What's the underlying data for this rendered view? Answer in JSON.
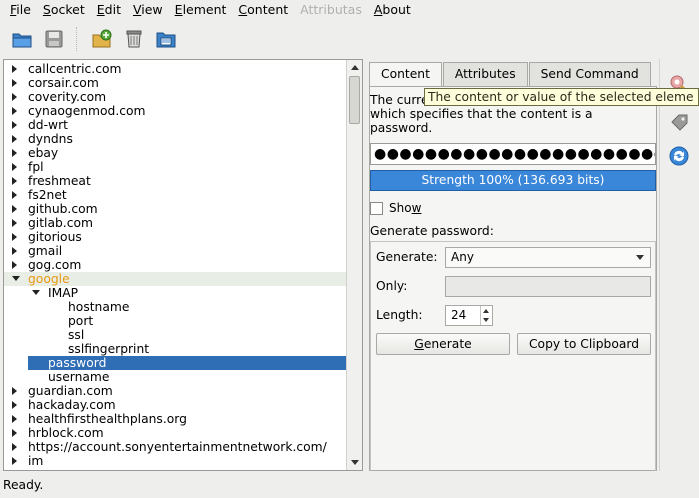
{
  "menubar": {
    "items": [
      {
        "label": "File",
        "key": "F",
        "rest": "ile",
        "enabled": true
      },
      {
        "label": "Socket",
        "key": "S",
        "rest": "ocket",
        "enabled": true
      },
      {
        "label": "Edit",
        "key": "E",
        "rest": "dit",
        "enabled": true
      },
      {
        "label": "View",
        "key": "V",
        "rest": "iew",
        "enabled": true
      },
      {
        "label": "Element",
        "key": "E",
        "rest": "lement",
        "enabled": true
      },
      {
        "label": "Content",
        "key": "C",
        "rest": "ontent",
        "enabled": true
      },
      {
        "label": "Attributas",
        "key": "",
        "rest": "Attributas",
        "enabled": false
      },
      {
        "label": "About",
        "key": "A",
        "rest": "bout",
        "enabled": true
      }
    ]
  },
  "toolbar": {
    "icons": [
      "open-folder-icon",
      "save-icon",
      "add-element-icon",
      "delete-icon",
      "properties-icon"
    ]
  },
  "tree": {
    "items": [
      {
        "label": "callcentric.com",
        "depth": 0,
        "expander": "closed",
        "state": ""
      },
      {
        "label": "corsair.com",
        "depth": 0,
        "expander": "closed",
        "state": ""
      },
      {
        "label": "coverity.com",
        "depth": 0,
        "expander": "closed",
        "state": ""
      },
      {
        "label": "cynaogenmod.com",
        "depth": 0,
        "expander": "closed",
        "state": ""
      },
      {
        "label": "dd-wrt",
        "depth": 0,
        "expander": "closed",
        "state": ""
      },
      {
        "label": "dyndns",
        "depth": 0,
        "expander": "closed",
        "state": ""
      },
      {
        "label": "ebay",
        "depth": 0,
        "expander": "closed",
        "state": ""
      },
      {
        "label": "fpl",
        "depth": 0,
        "expander": "closed",
        "state": ""
      },
      {
        "label": "freshmeat",
        "depth": 0,
        "expander": "closed",
        "state": ""
      },
      {
        "label": "fs2net",
        "depth": 0,
        "expander": "closed",
        "state": ""
      },
      {
        "label": "github.com",
        "depth": 0,
        "expander": "closed",
        "state": ""
      },
      {
        "label": "gitlab.com",
        "depth": 0,
        "expander": "closed",
        "state": ""
      },
      {
        "label": "gitorious",
        "depth": 0,
        "expander": "closed",
        "state": ""
      },
      {
        "label": "gmail",
        "depth": 0,
        "expander": "closed",
        "state": ""
      },
      {
        "label": "gog.com",
        "depth": 0,
        "expander": "closed",
        "state": ""
      },
      {
        "label": "google",
        "depth": 0,
        "expander": "open",
        "state": "hover"
      },
      {
        "label": "IMAP",
        "depth": 1,
        "expander": "open",
        "state": ""
      },
      {
        "label": "hostname",
        "depth": 2,
        "expander": "",
        "state": ""
      },
      {
        "label": "port",
        "depth": 2,
        "expander": "",
        "state": ""
      },
      {
        "label": "ssl",
        "depth": 2,
        "expander": "",
        "state": ""
      },
      {
        "label": "sslfingerprint",
        "depth": 2,
        "expander": "",
        "state": ""
      },
      {
        "label": "password",
        "depth": 1,
        "expander": "",
        "state": "selected"
      },
      {
        "label": "username",
        "depth": 1,
        "expander": "",
        "state": ""
      },
      {
        "label": "guardian.com",
        "depth": 0,
        "expander": "closed",
        "state": ""
      },
      {
        "label": "hackaday.com",
        "depth": 0,
        "expander": "closed",
        "state": ""
      },
      {
        "label": "healthfirsthealthplans.org",
        "depth": 0,
        "expander": "closed",
        "state": ""
      },
      {
        "label": "hrblock.com",
        "depth": 0,
        "expander": "closed",
        "state": ""
      },
      {
        "label": "https://account.sonyentertainmentnetwork.com/",
        "depth": 0,
        "expander": "closed",
        "state": ""
      },
      {
        "label": "im",
        "depth": 0,
        "expander": "closed",
        "state": ""
      }
    ]
  },
  "tabs": [
    {
      "label": "Content",
      "active": true
    },
    {
      "label": "Attributes",
      "active": false
    },
    {
      "label": "Send Command",
      "active": false
    }
  ],
  "content": {
    "description_line1": "The curre",
    "description_line2": "which specifies that the content is a",
    "description_line3": "password.",
    "password_mask": "●●●●●●●●●●●●●●●●●●●●●●●●●",
    "strength": "Strength 100% (136.693 bits)",
    "show_label_pre": "Sho",
    "show_label_key": "w",
    "show_checked": false,
    "generate_title": "Generate password:",
    "generate_label": "Generate:",
    "generate_value": "Any",
    "only_label": "Only:",
    "only_value": "",
    "length_label": "Length:",
    "length_value": "24",
    "generate_button_key": "G",
    "generate_button_rest": "enerate",
    "copy_button": "Copy to Clipboard"
  },
  "tooltip": {
    "text": "The content or value of the selected eleme"
  },
  "side_icons": [
    "key-lock-icon",
    "tag-icon",
    "refresh-icon"
  ],
  "status": {
    "text": "Ready."
  },
  "colors": {
    "selection": "#2f6db5",
    "hover_text": "#e89a14",
    "strength_bar": "#3a86d8"
  }
}
